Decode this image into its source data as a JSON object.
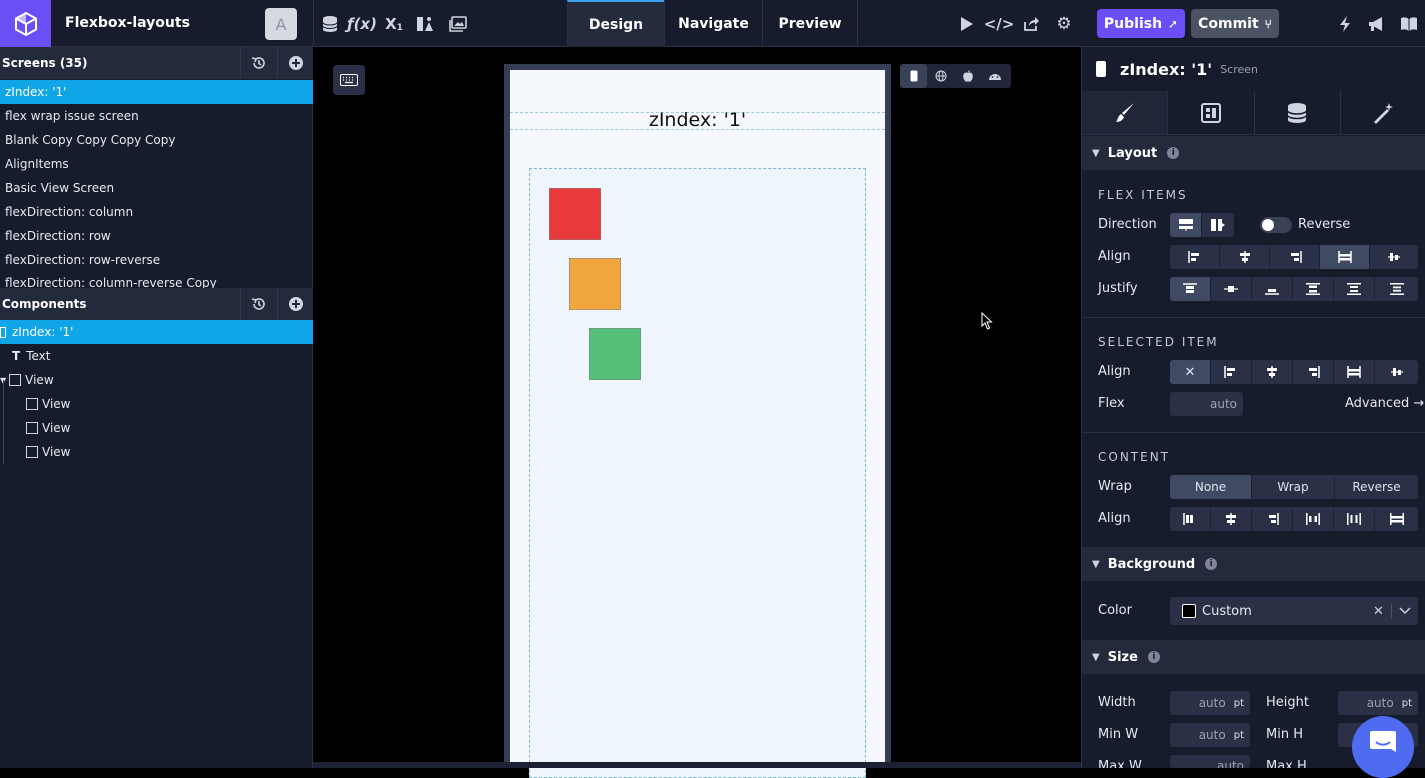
{
  "header": {
    "project_name": "Flexbox-layouts",
    "avatar_letter": "A",
    "mode_tabs": [
      {
        "label": "Design",
        "active": true
      },
      {
        "label": "Navigate",
        "active": false
      },
      {
        "label": "Preview",
        "active": false
      }
    ],
    "publish_label": "Publish",
    "commit_label": "Commit",
    "accent_color": "#6b4ef6"
  },
  "screens": {
    "title": "Screens (35)",
    "items": [
      {
        "label": "zIndex: '1'",
        "selected": true
      },
      {
        "label": "flex wrap issue screen"
      },
      {
        "label": "Blank Copy Copy Copy Copy"
      },
      {
        "label": "AlignItems"
      },
      {
        "label": "Basic View Screen"
      },
      {
        "label": "flexDirection: column"
      },
      {
        "label": "flexDirection: row"
      },
      {
        "label": "flexDirection: row-reverse"
      },
      {
        "label": "flexDirection: column-reverse Copy"
      }
    ]
  },
  "components": {
    "title": "Components",
    "items": [
      {
        "label": "zIndex: '1'",
        "selected": true
      },
      {
        "label": "Text"
      },
      {
        "label": "View"
      },
      {
        "label": "View"
      },
      {
        "label": "View"
      },
      {
        "label": "View"
      }
    ]
  },
  "canvas": {
    "screen_title": "zIndex: '1'",
    "square_colors": [
      "#e83a3a",
      "#f2a640",
      "#55c07a"
    ]
  },
  "inspector": {
    "title": "zIndex: '1'",
    "subtitle": "Screen",
    "layout": {
      "group": "Layout",
      "flex_items_caption": "FLEX ITEMS",
      "direction_label": "Direction",
      "reverse_label": "Reverse",
      "align_label": "Align",
      "justify_label": "Justify"
    },
    "selected_item": {
      "caption": "SELECTED ITEM",
      "align_label": "Align",
      "flex_label": "Flex",
      "flex_value": "auto",
      "advanced_label": "Advanced →"
    },
    "content": {
      "caption": "CONTENT",
      "wrap_label": "Wrap",
      "wrap_options": [
        "None",
        "Wrap",
        "Reverse"
      ],
      "align_label": "Align"
    },
    "background": {
      "group": "Background",
      "color_label": "Color",
      "color_value": "Custom"
    },
    "size": {
      "group": "Size",
      "width_label": "Width",
      "width_value": "auto",
      "height_label": "Height",
      "height_value": "auto",
      "minw_label": "Min W",
      "minw_value": "auto",
      "minh_label": "Min H",
      "maxw_label": "Max W",
      "maxw_value": "auto",
      "maxh_label": "Max H",
      "unit": "pt"
    }
  }
}
